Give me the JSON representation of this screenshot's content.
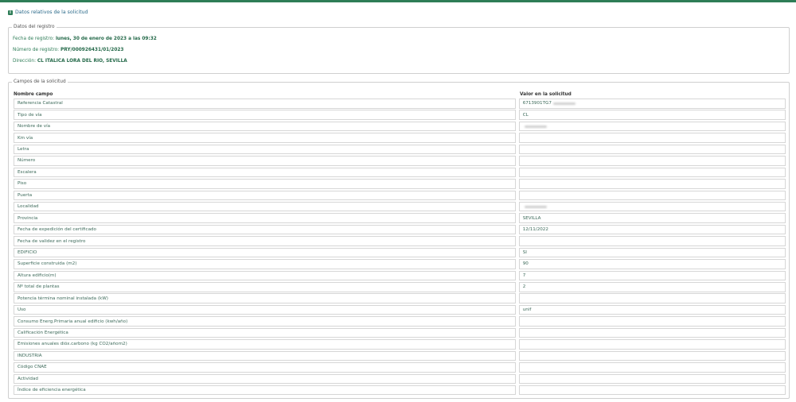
{
  "section": {
    "title": "Datos relativos de la solicitud"
  },
  "registro": {
    "legend": "Datos del registro",
    "fecha_label": "Fecha de registro:",
    "fecha_value": "lunes, 30 de enero de 2023 a las 09:32",
    "numero_label": "Número de registro:",
    "numero_value": "PRY/000926431/01/2023",
    "direccion_label": "Dirección:",
    "direccion_value": "CL ITALICA LORA DEL RIO, SEVILLA"
  },
  "campos": {
    "legend": "Campos de la solicitud",
    "col_name": "Nombre campo",
    "col_value": "Valor en la solicitud",
    "rows": [
      {
        "name": "Referencia Catastral",
        "value": "6713901TG7"
      },
      {
        "name": "Tipo de vía",
        "value": "CL"
      },
      {
        "name": "Nombre de vía",
        "value": ""
      },
      {
        "name": "Km vía",
        "value": ""
      },
      {
        "name": "Letra",
        "value": ""
      },
      {
        "name": "Número",
        "value": ""
      },
      {
        "name": "Escalera",
        "value": ""
      },
      {
        "name": "Piso",
        "value": ""
      },
      {
        "name": "Puerta",
        "value": ""
      },
      {
        "name": "Localidad",
        "value": ""
      },
      {
        "name": "Provincia",
        "value": "SEVILLA"
      },
      {
        "name": "Fecha de expedición del certificado",
        "value": "12/11/2022"
      },
      {
        "name": "Fecha de validez en el registro",
        "value": ""
      },
      {
        "name": "EDIFICIO",
        "value": "SI"
      },
      {
        "name": "Superficie construida (m2)",
        "value": "90"
      },
      {
        "name": "Altura edificio(m)",
        "value": "7"
      },
      {
        "name": "Nº total de plantas",
        "value": "2"
      },
      {
        "name": "Potencia términa nominal instalada (kW)",
        "value": ""
      },
      {
        "name": "Uso",
        "value": "unif"
      },
      {
        "name": "Consumo Energ.Primaria anual edificio (kwh/año)",
        "value": ""
      },
      {
        "name": "Calificación Energética",
        "value": ""
      },
      {
        "name": "Emisiones anuales dióx.carbono (kg CO2/añom2)",
        "value": ""
      },
      {
        "name": "INDUSTRIA",
        "value": ""
      },
      {
        "name": "Código CNAE",
        "value": ""
      },
      {
        "name": "Actividad",
        "value": ""
      },
      {
        "name": "Índice de eficiencia energética",
        "value": ""
      }
    ]
  }
}
